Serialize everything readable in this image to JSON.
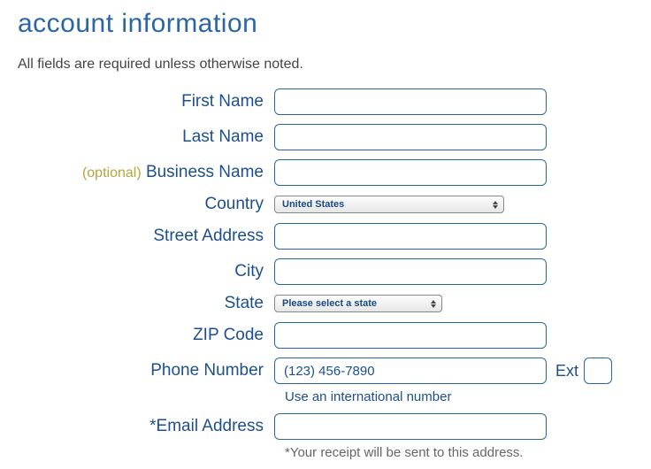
{
  "heading": "account information",
  "subhead": "All fields are required unless otherwise noted.",
  "optional_tag": "(optional)",
  "labels": {
    "first_name": "First Name",
    "last_name": "Last Name",
    "business_name": "Business Name",
    "country": "Country",
    "street": "Street Address",
    "city": "City",
    "state": "State",
    "zip": "ZIP Code",
    "phone": "Phone Number",
    "ext": "Ext",
    "email": "*Email Address"
  },
  "values": {
    "first_name": "",
    "last_name": "",
    "business_name": "",
    "country_selected": "United States",
    "street": "",
    "city": "",
    "state_selected": "Please select a state",
    "zip": "",
    "phone": "",
    "phone_placeholder": "(123) 456-7890",
    "ext": "",
    "email": ""
  },
  "helpers": {
    "intl": "Use an international number",
    "receipt": "*Your receipt will be sent to this address."
  }
}
